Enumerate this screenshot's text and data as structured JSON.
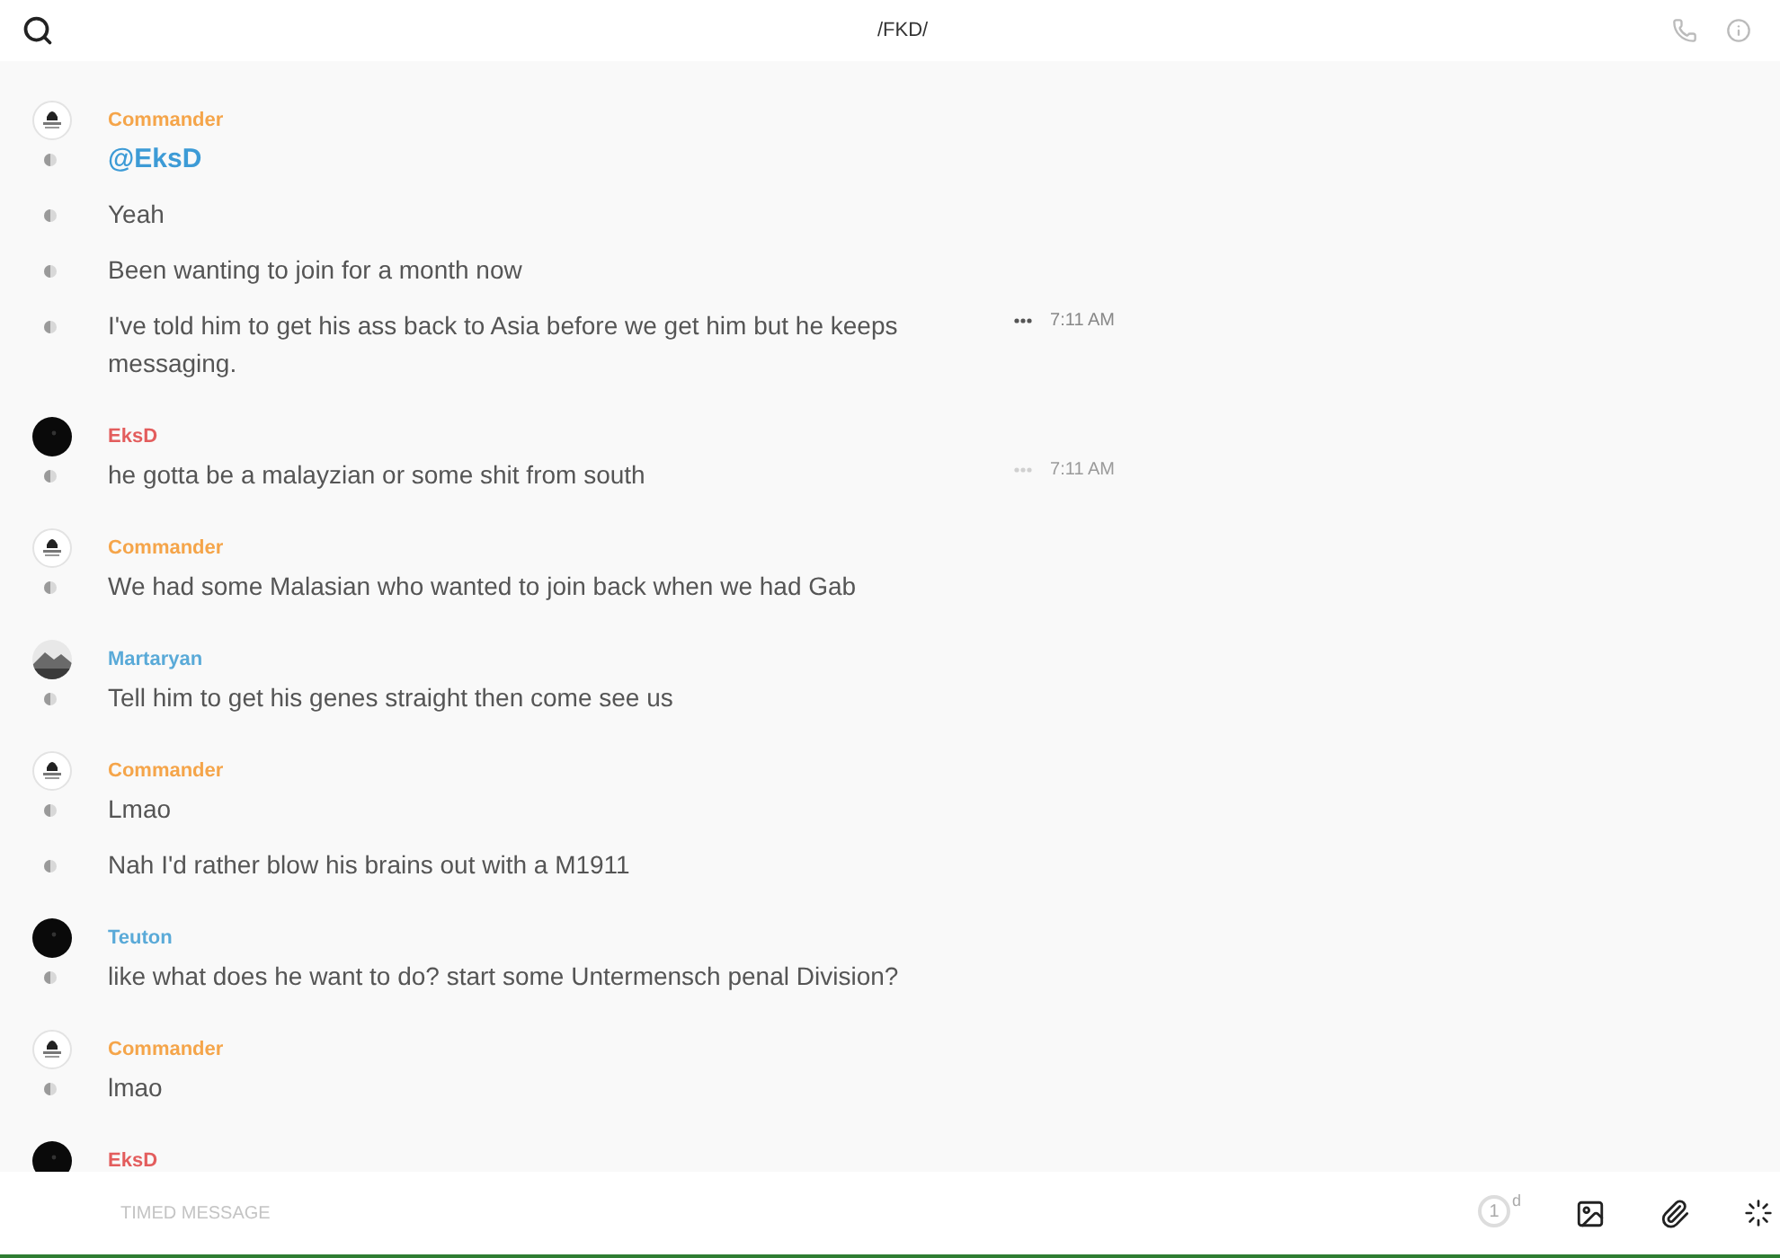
{
  "header": {
    "title": "/FKD/"
  },
  "groups": [
    {
      "author": "Commander",
      "color": "#f5a54a",
      "avatar": {
        "kind": "emblem"
      },
      "messages": [
        {
          "kind": "mention",
          "text": "@EksD"
        },
        {
          "kind": "text",
          "text": "Yeah"
        },
        {
          "kind": "text",
          "text": "Been wanting to join for a month now"
        },
        {
          "kind": "text",
          "text": "I've told him to get his ass back to Asia before we get him but he keeps messaging.",
          "time": "7:11 AM",
          "faded": false
        }
      ]
    },
    {
      "author": "EksD",
      "color": "#e35d5d",
      "avatar": {
        "kind": "dark"
      },
      "messages": [
        {
          "kind": "text",
          "text": "he gotta be a malayzian or some shit from south",
          "time": "7:11 AM",
          "faded": true
        }
      ]
    },
    {
      "author": "Commander",
      "color": "#f5a54a",
      "avatar": {
        "kind": "emblem"
      },
      "messages": [
        {
          "kind": "text",
          "text": "We had some Malasian who wanted to join back when we had Gab"
        }
      ]
    },
    {
      "author": "Martaryan",
      "color": "#5aaad8",
      "avatar": {
        "kind": "landscape"
      },
      "messages": [
        {
          "kind": "text",
          "text": "Tell him to get his genes straight then come see us"
        }
      ]
    },
    {
      "author": "Commander",
      "color": "#f5a54a",
      "avatar": {
        "kind": "emblem"
      },
      "messages": [
        {
          "kind": "text",
          "text": "Lmao"
        },
        {
          "kind": "text",
          "text": "Nah I'd rather blow his brains out with a M1911"
        }
      ]
    },
    {
      "author": "Teuton",
      "color": "#5aaad8",
      "avatar": {
        "kind": "dark"
      },
      "messages": [
        {
          "kind": "text",
          "text": "like what does he want to do? start some Untermensch penal Division?"
        }
      ]
    },
    {
      "author": "Commander",
      "color": "#f5a54a",
      "avatar": {
        "kind": "emblem"
      },
      "messages": [
        {
          "kind": "text",
          "text": "lmao"
        }
      ]
    },
    {
      "author": "EksD",
      "color": "#e35d5d",
      "avatar": {
        "kind": "dark"
      }
    }
  ],
  "composer": {
    "placeholder": "TIMED MESSAGE",
    "timer": "1",
    "timer_unit": "d"
  }
}
